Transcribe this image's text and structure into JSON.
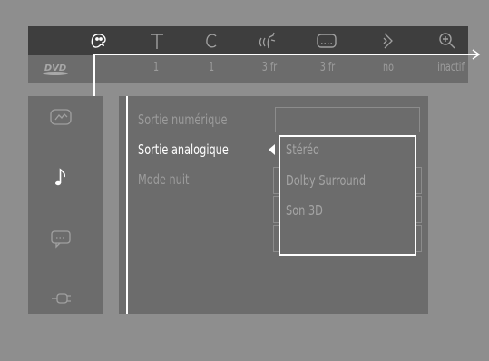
{
  "toolbar": {
    "icons": [
      {
        "name": "personal-settings-icon",
        "active": true
      },
      {
        "name": "text-icon",
        "active": false
      },
      {
        "name": "c-icon",
        "active": false
      },
      {
        "name": "audio-icon",
        "active": false
      },
      {
        "name": "subtitle-icon",
        "active": false
      },
      {
        "name": "angle-icon",
        "active": false
      },
      {
        "name": "zoom-icon",
        "active": false
      }
    ],
    "disc_type": "DVD",
    "values": [
      "1",
      "1",
      "3 fr",
      "3 fr",
      "no",
      "inactif"
    ]
  },
  "sidebar": {
    "items": [
      {
        "name": "picture-settings-icon",
        "active": false
      },
      {
        "name": "sound-settings-icon",
        "active": true
      },
      {
        "name": "language-settings-icon",
        "active": false
      },
      {
        "name": "features-settings-icon",
        "active": false
      }
    ]
  },
  "menu": {
    "items": [
      {
        "label": "Sortie numérique",
        "selected": false
      },
      {
        "label": "Sortie analogique",
        "selected": true
      },
      {
        "label": "Mode nuit",
        "selected": false
      }
    ]
  },
  "options": {
    "items": [
      "Stéréo",
      "Dolby Surround",
      "Son 3D"
    ]
  },
  "colors": {
    "background": "#8e8e8e",
    "panel": "#6c6c6c",
    "icon_bar": "#3e3e3e",
    "highlight": "#ffffff",
    "dim_text": "#9c9c9c"
  }
}
